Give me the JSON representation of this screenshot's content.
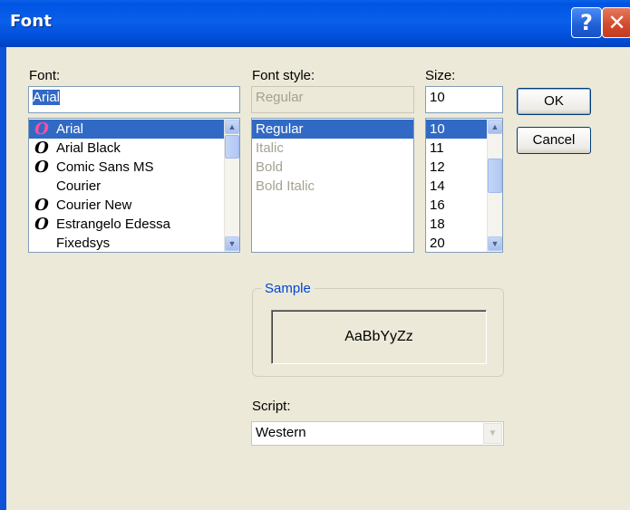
{
  "window": {
    "title": "Font",
    "help_glyph": "?",
    "close_glyph": "✕"
  },
  "font": {
    "label": "Font:",
    "input_value": "Arial",
    "items": [
      {
        "label": "Arial",
        "icon": "opentype-icon",
        "selected": true
      },
      {
        "label": "Arial Black",
        "icon": "opentype-icon"
      },
      {
        "label": "Comic Sans MS",
        "icon": "opentype-icon"
      },
      {
        "label": "Courier",
        "icon": ""
      },
      {
        "label": "Courier New",
        "icon": "opentype-icon"
      },
      {
        "label": "Estrangelo Edessa",
        "icon": "opentype-icon"
      },
      {
        "label": "Fixedsys",
        "icon": ""
      }
    ],
    "icon_glyph": "O"
  },
  "font_style": {
    "label": "Font style:",
    "input_value": "Regular",
    "items": [
      {
        "label": "Regular",
        "selected": true
      },
      {
        "label": "Italic"
      },
      {
        "label": "Bold"
      },
      {
        "label": "Bold Italic"
      }
    ]
  },
  "size": {
    "label": "Size:",
    "input_value": "10",
    "items": [
      {
        "label": "10",
        "selected": true
      },
      {
        "label": "11"
      },
      {
        "label": "12"
      },
      {
        "label": "14"
      },
      {
        "label": "16"
      },
      {
        "label": "18"
      },
      {
        "label": "20"
      }
    ]
  },
  "buttons": {
    "ok": "OK",
    "cancel": "Cancel"
  },
  "sample": {
    "label": "Sample",
    "text": "AaBbYyZz"
  },
  "script": {
    "label": "Script:",
    "value": "Western"
  },
  "colors": {
    "titlebar": "#0054E3",
    "selection": "#316AC5",
    "dialog_bg": "#ECE9D8",
    "group_label": "#0046D5"
  }
}
